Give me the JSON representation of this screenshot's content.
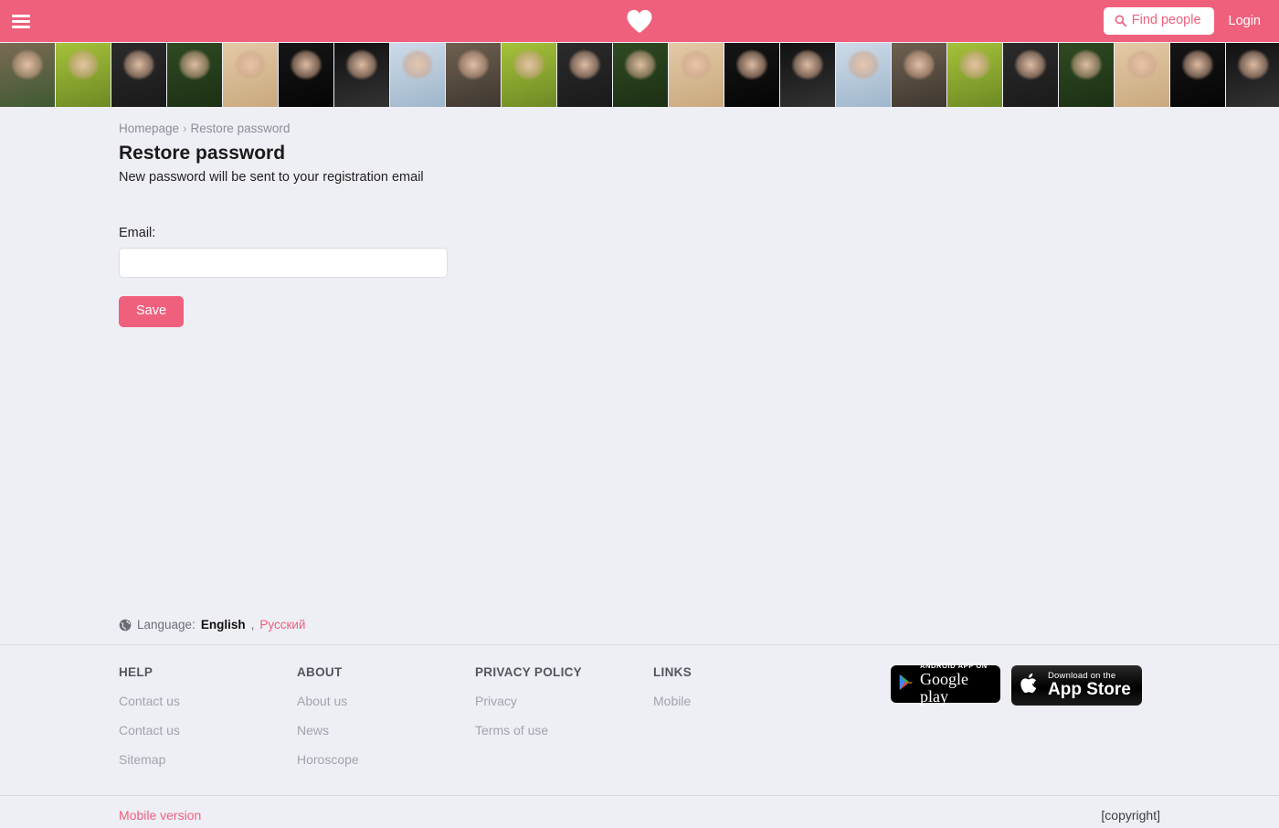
{
  "header": {
    "menu_icon": "hamburger-menu-icon",
    "logo_icon": "heart-logo-icon",
    "find_people_label": "Find people",
    "find_people_icon": "search-icon",
    "login_label": "Login"
  },
  "photo_strip": {
    "count": 23,
    "thumbnails": [
      {
        "alt": "profile-photo-1",
        "bg": "#7b6a54",
        "bg2": "#3e5a33"
      },
      {
        "alt": "profile-photo-2",
        "bg": "#a6c13a",
        "bg2": "#6d8a24"
      },
      {
        "alt": "profile-photo-3",
        "bg": "#2b2b2b",
        "bg2": "#1a1a1a"
      },
      {
        "alt": "profile-photo-4",
        "bg": "#2f4a22",
        "bg2": "#1c3014"
      },
      {
        "alt": "profile-photo-5",
        "bg": "#e3c9a6",
        "bg2": "#c9a97e"
      },
      {
        "alt": "profile-photo-6",
        "bg": "#161616",
        "bg2": "#050505"
      },
      {
        "alt": "profile-photo-7",
        "bg": "#111111",
        "bg2": "#333333"
      },
      {
        "alt": "profile-photo-8",
        "bg": "#cddbe8",
        "bg2": "#9fb6cb"
      },
      {
        "alt": "profile-photo-9",
        "bg": "#6f6050",
        "bg2": "#3e3830"
      },
      {
        "alt": "profile-photo-10",
        "bg": "#a6c13a",
        "bg2": "#6d8a24"
      },
      {
        "alt": "profile-photo-11",
        "bg": "#2b2b2b",
        "bg2": "#1a1a1a"
      },
      {
        "alt": "profile-photo-12",
        "bg": "#2f4a22",
        "bg2": "#1c3014"
      },
      {
        "alt": "profile-photo-13",
        "bg": "#e3c9a6",
        "bg2": "#c9a97e"
      },
      {
        "alt": "profile-photo-14",
        "bg": "#161616",
        "bg2": "#050505"
      },
      {
        "alt": "profile-photo-15",
        "bg": "#111111",
        "bg2": "#333333"
      },
      {
        "alt": "profile-photo-16",
        "bg": "#cddbe8",
        "bg2": "#9fb6cb"
      },
      {
        "alt": "profile-photo-17",
        "bg": "#6f6050",
        "bg2": "#3e3830"
      },
      {
        "alt": "profile-photo-18",
        "bg": "#a6c13a",
        "bg2": "#6d8a24"
      },
      {
        "alt": "profile-photo-19",
        "bg": "#2b2b2b",
        "bg2": "#1a1a1a"
      },
      {
        "alt": "profile-photo-20",
        "bg": "#2f4a22",
        "bg2": "#1c3014"
      },
      {
        "alt": "profile-photo-21",
        "bg": "#e3c9a6",
        "bg2": "#c9a97e"
      },
      {
        "alt": "profile-photo-22",
        "bg": "#161616",
        "bg2": "#050505"
      },
      {
        "alt": "profile-photo-23",
        "bg": "#111111",
        "bg2": "#333333"
      }
    ]
  },
  "breadcrumb": {
    "home_label": "Homepage",
    "separator": "›",
    "current_label": "Restore password"
  },
  "main": {
    "title": "Restore password",
    "subtitle": "New password will be sent to your registration email",
    "email_label": "Email:",
    "email_value": "",
    "email_placeholder": "",
    "save_label": "Save"
  },
  "language": {
    "icon": "globe-icon",
    "label": "Language:",
    "current": "English",
    "comma": ",",
    "alternate": "Русский"
  },
  "footer": {
    "columns": [
      {
        "heading": "HELP",
        "links": [
          "Contact us",
          "Contact us",
          "Sitemap"
        ]
      },
      {
        "heading": "ABOUT",
        "links": [
          "About us",
          "News",
          "Horoscope"
        ]
      },
      {
        "heading": "PRIVACY POLICY",
        "links": [
          "Privacy",
          "Terms of use"
        ]
      },
      {
        "heading": "LINKS",
        "links": [
          "Mobile"
        ]
      }
    ],
    "badges": {
      "google_small": "ANDROID APP ON",
      "google_big": "Google play",
      "google_icon": "google-play-icon",
      "apple_small": "Download on the",
      "apple_big": "App Store",
      "apple_icon": "apple-logo-icon"
    }
  },
  "bottom": {
    "mobile_version_label": "Mobile version",
    "copyright": "[copyright]"
  },
  "colors": {
    "accent": "#ef607d",
    "page_bg": "#eeeef5",
    "footer_link": "#a3a3ae",
    "divider": "#d9d9e5"
  }
}
